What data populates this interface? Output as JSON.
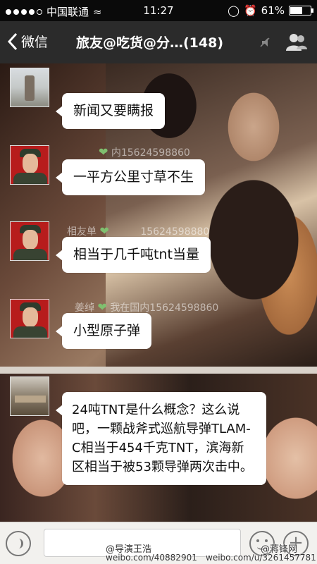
{
  "status_bar": {
    "carrier": "中国联通",
    "time": "11:27",
    "battery": "61%",
    "signal_dots_filled": 4,
    "signal_dots_total": 5,
    "battery_level": 0.61
  },
  "nav": {
    "back_label": "微信",
    "title": "旅友@吃货@分…(148)",
    "icons": [
      "back-chevron-icon",
      "mute-icon",
      "group-members-icon"
    ]
  },
  "messages": [
    {
      "avatar": "landscape",
      "text": "新闻又要瞒报"
    },
    {
      "avatar": "soldier",
      "text": "一平方公里寸草不生"
    },
    {
      "avatar": "soldier",
      "text": "相当于几千吨tnt当量"
    },
    {
      "avatar": "soldier",
      "text": "小型原子弹"
    },
    {
      "avatar": "scene",
      "text": "24吨TNT是什么概念？这么说吧，一颗战斧式巡航导弹TLAM-C相当于454千克TNT，滨海新区相当于被53颗导弹两次击中。"
    }
  ],
  "overlay_tags": {
    "tag1": "内15624598860",
    "tag2": "相友单",
    "tag3": "15624598880",
    "tag4": "姜绰",
    "tag5": "我在国内15624598860"
  },
  "input_bar": {
    "icons": [
      "voice-icon",
      "emoji-icon",
      "plus-icon"
    ]
  },
  "watermark": {
    "left_handle": "@导演王浩",
    "left_url": "weibo.com/40882901",
    "right_handle": "@蒋锋网",
    "right_url": "weibo.com/u/3261457781"
  },
  "colors": {
    "nav_bg": "#2b2b2b",
    "bubble_bg": "#ffffff",
    "avatar_soldier_bg": "#b71c1c"
  }
}
